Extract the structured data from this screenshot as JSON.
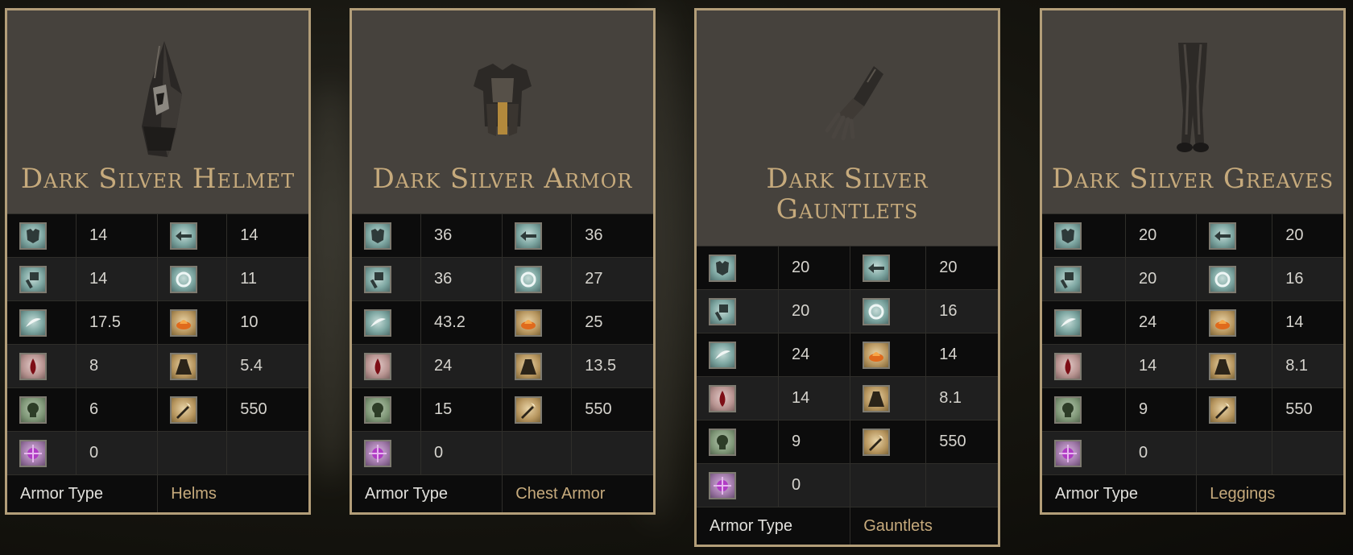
{
  "stat_icons": {
    "left": [
      "physical-defense-icon",
      "strike-defense-icon",
      "slash-defense-icon",
      "bleed-resist-icon",
      "poison-resist-icon",
      "madness-resist-icon"
    ],
    "right": [
      "pierce-defense-icon",
      "magic-defense-icon",
      "fire-defense-icon",
      "weight-icon",
      "durability-icon"
    ]
  },
  "armor_type_label": "Armor Type",
  "cards": [
    {
      "title": "Dark Silver Helmet",
      "left_values": [
        "14",
        "14",
        "17.5",
        "8",
        "6",
        "0"
      ],
      "right_values": [
        "14",
        "11",
        "10",
        "5.4",
        "550"
      ],
      "armor_type": "Helms"
    },
    {
      "title": "Dark Silver Armor",
      "left_values": [
        "36",
        "36",
        "43.2",
        "24",
        "15",
        "0"
      ],
      "right_values": [
        "36",
        "27",
        "25",
        "13.5",
        "550"
      ],
      "armor_type": "Chest Armor"
    },
    {
      "title": "Dark Silver Gauntlets",
      "left_values": [
        "20",
        "20",
        "24",
        "14",
        "9",
        "0"
      ],
      "right_values": [
        "20",
        "16",
        "14",
        "8.1",
        "550"
      ],
      "armor_type": "Gauntlets"
    },
    {
      "title": "Dark Silver Greaves",
      "left_values": [
        "20",
        "20",
        "24",
        "14",
        "9",
        "0"
      ],
      "right_values": [
        "20",
        "16",
        "14",
        "8.1",
        "550"
      ],
      "armor_type": "Leggings"
    }
  ],
  "colors": {
    "accent_gold": "#c6aa7c",
    "border": "#b39e79",
    "header_bg": "#46423d"
  }
}
